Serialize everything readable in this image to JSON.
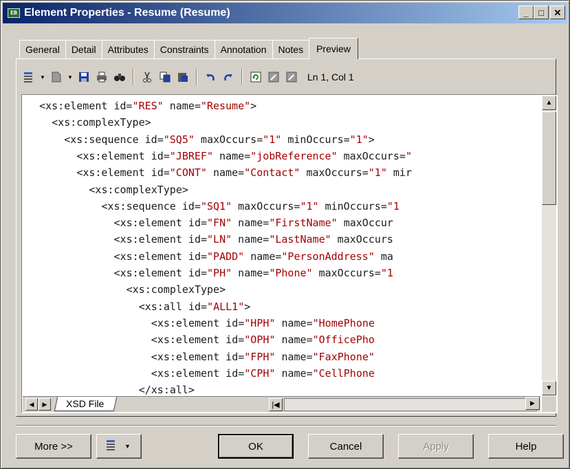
{
  "window": {
    "title": "Element Properties - Resume (Resume)",
    "icon_text": "EB",
    "minimize": "_",
    "maximize": "□",
    "close": "✕"
  },
  "tabs": [
    {
      "label": "General",
      "active": false
    },
    {
      "label": "Detail",
      "active": false
    },
    {
      "label": "Attributes",
      "active": false
    },
    {
      "label": "Constraints",
      "active": false
    },
    {
      "label": "Annotation",
      "active": false
    },
    {
      "label": "Notes",
      "active": false
    },
    {
      "label": "Preview",
      "active": true
    }
  ],
  "toolbar": {
    "icons": [
      "align-icon",
      "new-page-icon",
      "save-icon",
      "print-icon",
      "find-icon",
      "cut-icon",
      "copy-icon",
      "paste-icon",
      "undo-icon",
      "redo-icon",
      "refresh-icon",
      "open-editor-icon",
      "close-editor-icon"
    ],
    "cursor_position": "Ln 1, Col 1"
  },
  "code": {
    "lines": [
      {
        "indent": 2,
        "parts": [
          [
            "<xs:element id=",
            0
          ],
          [
            "\"RES\"",
            1
          ],
          [
            " name=",
            0
          ],
          [
            "\"Resume\"",
            1
          ],
          [
            ">",
            0
          ]
        ]
      },
      {
        "indent": 4,
        "parts": [
          [
            "<xs:complexType>",
            0
          ]
        ]
      },
      {
        "indent": 6,
        "parts": [
          [
            "<xs:sequence id=",
            0
          ],
          [
            "\"SQ5\"",
            1
          ],
          [
            " maxOccurs=",
            0
          ],
          [
            "\"1\"",
            1
          ],
          [
            " minOccurs=",
            0
          ],
          [
            "\"1\"",
            1
          ],
          [
            ">",
            0
          ]
        ]
      },
      {
        "indent": 8,
        "parts": [
          [
            "<xs:element id=",
            0
          ],
          [
            "\"JBREF\"",
            1
          ],
          [
            " name=",
            0
          ],
          [
            "\"jobReference\"",
            1
          ],
          [
            " maxOccurs=",
            0
          ],
          [
            "\"",
            1
          ]
        ]
      },
      {
        "indent": 8,
        "parts": [
          [
            "<xs:element id=",
            0
          ],
          [
            "\"CONT\"",
            1
          ],
          [
            " name=",
            0
          ],
          [
            "\"Contact\"",
            1
          ],
          [
            " maxOccurs=",
            0
          ],
          [
            "\"1\"",
            1
          ],
          [
            " mir",
            0
          ]
        ]
      },
      {
        "indent": 10,
        "parts": [
          [
            "<xs:complexType>",
            0
          ]
        ]
      },
      {
        "indent": 12,
        "parts": [
          [
            "<xs:sequence id=",
            0
          ],
          [
            "\"SQ1\"",
            1
          ],
          [
            " maxOccurs=",
            0
          ],
          [
            "\"1\"",
            1
          ],
          [
            " minOccurs=",
            0
          ],
          [
            "\"1",
            1
          ]
        ]
      },
      {
        "indent": 14,
        "parts": [
          [
            "<xs:element id=",
            0
          ],
          [
            "\"FN\"",
            1
          ],
          [
            " name=",
            0
          ],
          [
            "\"FirstName\"",
            1
          ],
          [
            " maxOccur",
            0
          ]
        ]
      },
      {
        "indent": 14,
        "parts": [
          [
            "<xs:element id=",
            0
          ],
          [
            "\"LN\"",
            1
          ],
          [
            " name=",
            0
          ],
          [
            "\"LastName\"",
            1
          ],
          [
            " maxOccurs",
            0
          ]
        ]
      },
      {
        "indent": 14,
        "parts": [
          [
            "<xs:element id=",
            0
          ],
          [
            "\"PADD\"",
            1
          ],
          [
            " name=",
            0
          ],
          [
            "\"PersonAddress\"",
            1
          ],
          [
            " ma",
            0
          ]
        ]
      },
      {
        "indent": 14,
        "parts": [
          [
            "<xs:element id=",
            0
          ],
          [
            "\"PH\"",
            1
          ],
          [
            " name=",
            0
          ],
          [
            "\"Phone\"",
            1
          ],
          [
            " maxOccurs=",
            0
          ],
          [
            "\"1",
            1
          ]
        ]
      },
      {
        "indent": 16,
        "parts": [
          [
            "<xs:complexType>",
            0
          ]
        ]
      },
      {
        "indent": 18,
        "parts": [
          [
            "<xs:all id=",
            0
          ],
          [
            "\"ALL1\"",
            1
          ],
          [
            ">",
            0
          ]
        ]
      },
      {
        "indent": 20,
        "parts": [
          [
            "<xs:element id=",
            0
          ],
          [
            "\"HPH\"",
            1
          ],
          [
            " name=",
            0
          ],
          [
            "\"HomePhone",
            1
          ]
        ]
      },
      {
        "indent": 20,
        "parts": [
          [
            "<xs:element id=",
            0
          ],
          [
            "\"OPH\"",
            1
          ],
          [
            " name=",
            0
          ],
          [
            "\"OfficePho",
            1
          ]
        ]
      },
      {
        "indent": 20,
        "parts": [
          [
            "<xs:element id=",
            0
          ],
          [
            "\"FPH\"",
            1
          ],
          [
            " name=",
            0
          ],
          [
            "\"FaxPhone\"",
            1
          ]
        ]
      },
      {
        "indent": 20,
        "parts": [
          [
            "<xs:element id=",
            0
          ],
          [
            "\"CPH\"",
            1
          ],
          [
            " name=",
            0
          ],
          [
            "\"CellPhone",
            1
          ]
        ]
      },
      {
        "indent": 18,
        "parts": [
          [
            "</xs:all>",
            0
          ]
        ]
      }
    ]
  },
  "file_tab": "XSD File",
  "buttons": {
    "more": "More >>",
    "ok": "OK",
    "cancel": "Cancel",
    "apply": "Apply",
    "help": "Help"
  }
}
